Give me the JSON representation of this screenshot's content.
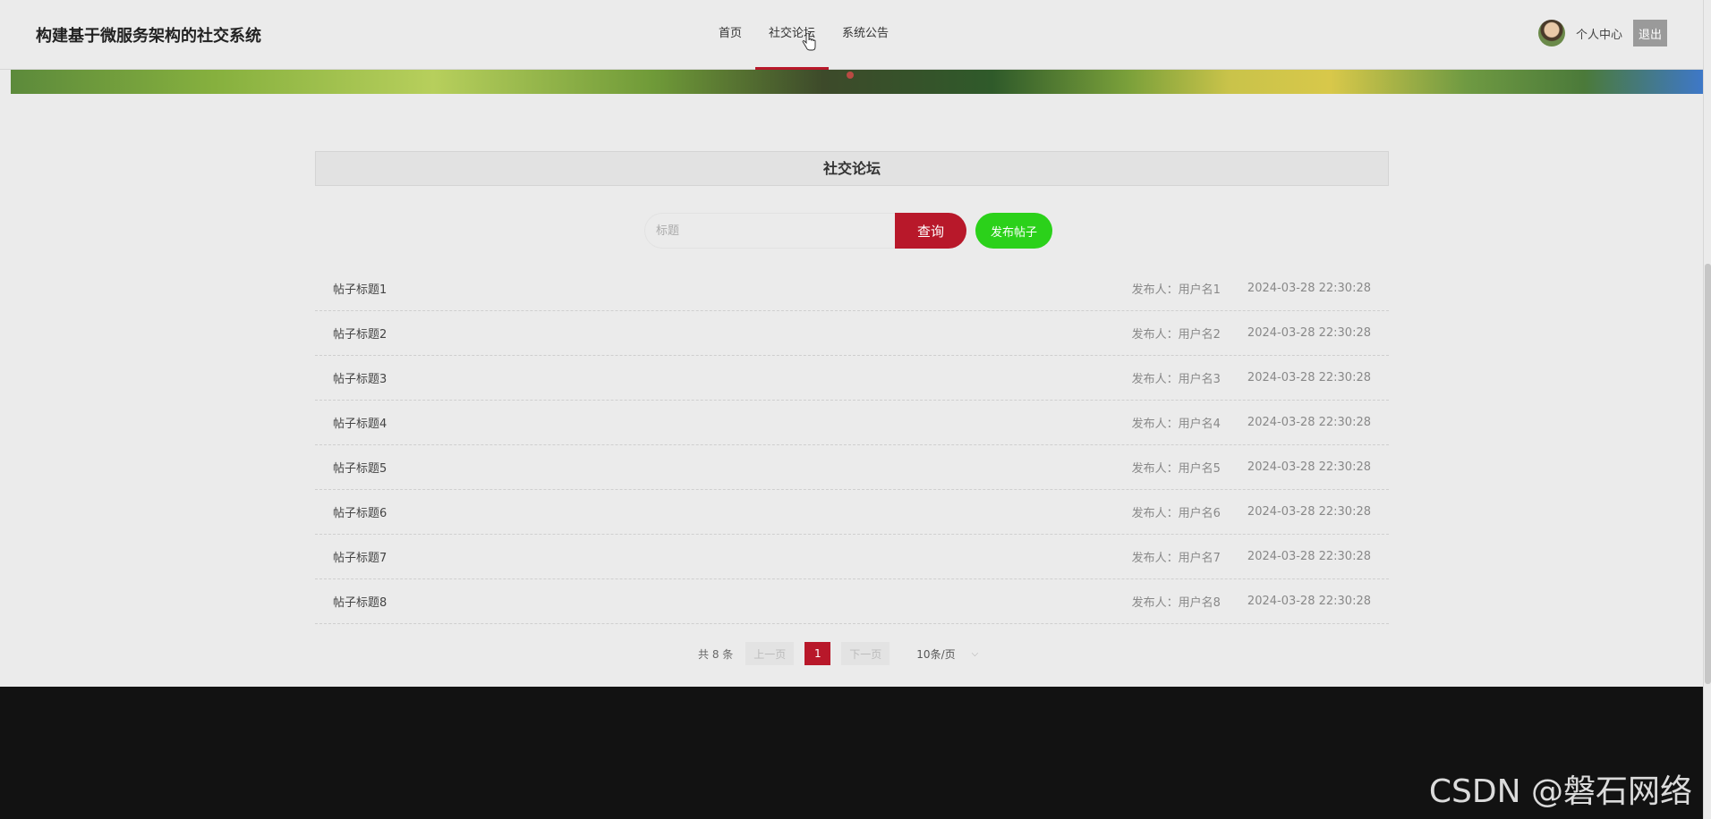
{
  "header": {
    "brand": "构建基于微服务架构的社交系统",
    "nav": [
      "首页",
      "社交论坛",
      "系统公告"
    ],
    "active_nav": "社交论坛",
    "user_center": "个人中心",
    "logout": "退出"
  },
  "forum": {
    "title": "社交论坛",
    "search": {
      "placeholder": "标题",
      "value": "",
      "button": "查询"
    },
    "post_button": "发布帖子",
    "posts": [
      {
        "title": "帖子标题1",
        "author": "发布人：用户名1",
        "time": "2024-03-28 22:30:28"
      },
      {
        "title": "帖子标题2",
        "author": "发布人：用户名2",
        "time": "2024-03-28 22:30:28"
      },
      {
        "title": "帖子标题3",
        "author": "发布人：用户名3",
        "time": "2024-03-28 22:30:28"
      },
      {
        "title": "帖子标题4",
        "author": "发布人：用户名4",
        "time": "2024-03-28 22:30:28"
      },
      {
        "title": "帖子标题5",
        "author": "发布人：用户名5",
        "time": "2024-03-28 22:30:28"
      },
      {
        "title": "帖子标题6",
        "author": "发布人：用户名6",
        "time": "2024-03-28 22:30:28"
      },
      {
        "title": "帖子标题7",
        "author": "发布人：用户名7",
        "time": "2024-03-28 22:30:28"
      },
      {
        "title": "帖子标题8",
        "author": "发布人：用户名8",
        "time": "2024-03-28 22:30:28"
      }
    ],
    "pagination": {
      "total": "共 8 条",
      "prev": "上一页",
      "current": "1",
      "next": "下一页",
      "page_size": "10条/页"
    }
  },
  "watermark": "CSDN @磐石网络",
  "colors": {
    "accent": "#b8182a",
    "post_button": "#2bd11a",
    "footer": "#121212"
  }
}
